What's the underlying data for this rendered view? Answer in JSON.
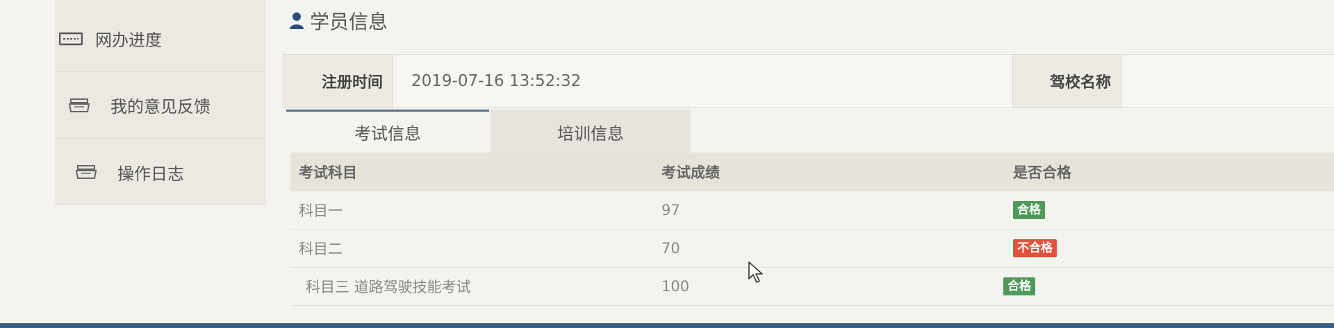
{
  "sidebar": {
    "items": [
      {
        "label": "网办进度",
        "icon": "progress-icon"
      },
      {
        "label": "我的意见反馈",
        "icon": "feedback-icon"
      },
      {
        "label": "操作日志",
        "icon": "log-icon"
      }
    ]
  },
  "section": {
    "title": "学员信息",
    "icon": "user-icon"
  },
  "info": {
    "register_label": "注册时间",
    "register_value": "2019-07-16 13:52:32",
    "school_label": "驾校名称",
    "school_value": ""
  },
  "tabs": [
    {
      "label": "考试信息",
      "active": true
    },
    {
      "label": "培训信息",
      "active": false
    }
  ],
  "table": {
    "headers": [
      "考试科目",
      "考试成绩",
      "是否合格"
    ],
    "rows": [
      {
        "subject": "科目一",
        "score": "97",
        "status": "合格",
        "pass": true
      },
      {
        "subject": "科目二",
        "score": "70",
        "status": "不合格",
        "pass": false
      },
      {
        "subject": "科目三 道路驾驶技能考试",
        "score": "100",
        "status": "合格",
        "pass": true
      }
    ]
  },
  "colors": {
    "pass": "#4f9a5a",
    "fail": "#e0533e",
    "tab_accent": "#5b6f8c"
  }
}
